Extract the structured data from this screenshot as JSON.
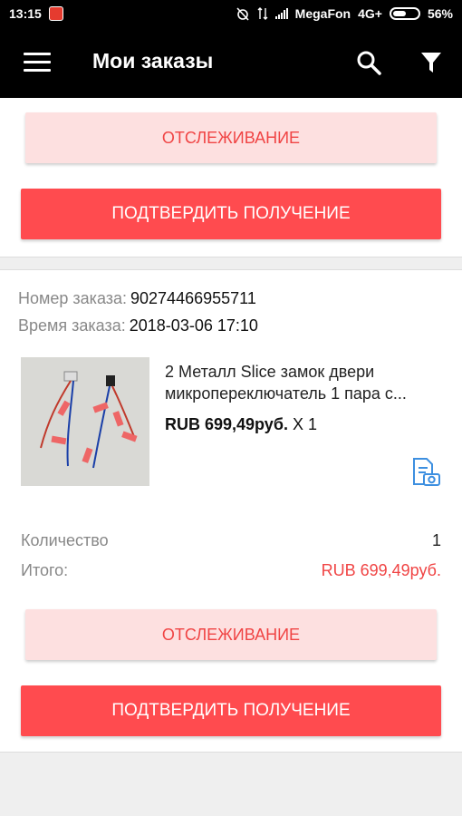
{
  "status_bar": {
    "time": "13:15",
    "carrier": "MegaFon",
    "network": "4G+",
    "battery": "56%"
  },
  "app_bar": {
    "title": "Мои заказы",
    "icons": [
      "menu-icon",
      "search-icon",
      "filter-icon"
    ]
  },
  "cards": [
    {
      "track_button": "ОТСЛЕЖИВАНИЕ",
      "confirm_button": "ПОДТВЕРДИТЬ ПОЛУЧЕНИЕ"
    },
    {
      "order_number_label": "Номер заказа:",
      "order_number": "90274466955711",
      "order_time_label": "Время заказа:",
      "order_time": "2018-03-06 17:10",
      "product": {
        "title_line1": "2 Металл Slice замок двери",
        "title_line2": "микропереключатель 1 пара с...",
        "price": "RUB 699,49руб.",
        "quantity_mark": "X 1"
      },
      "quantity_label": "Количество",
      "quantity": "1",
      "total_label": "Итого:",
      "total": "RUB 699,49руб.",
      "track_button": "ОТСЛЕЖИВАНИЕ",
      "confirm_button": "ПОДТВЕРДИТЬ ПОЛУЧЕНИЕ"
    }
  ],
  "colors": {
    "accent_red": "#ff4b4f",
    "track_bg": "#fde0e0",
    "link_blue": "#3d8fe0"
  }
}
